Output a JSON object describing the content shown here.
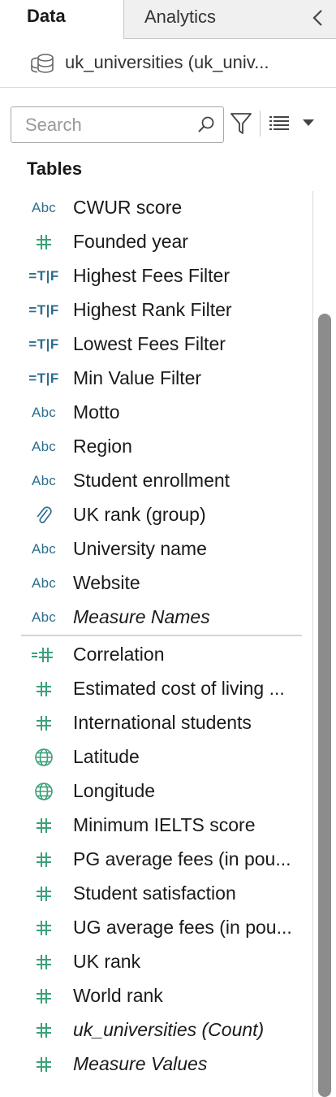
{
  "tabs": {
    "data": "Data",
    "analytics": "Analytics"
  },
  "datasource": {
    "name": "uk_universities (uk_univ..."
  },
  "search": {
    "placeholder": "Search"
  },
  "tables_heading": "Tables",
  "colors": {
    "accent_blue": "#2d6d8f",
    "measure_green": "#3aa178",
    "scrollbar": "#8c8c8c"
  },
  "dimensions": [
    {
      "icon": "abc",
      "label": "CWUR score"
    },
    {
      "icon": "number",
      "label": "Founded year"
    },
    {
      "icon": "calc-filter",
      "label": "Highest Fees Filter"
    },
    {
      "icon": "calc-filter",
      "label": "Highest Rank Filter"
    },
    {
      "icon": "calc-filter",
      "label": "Lowest Fees Filter"
    },
    {
      "icon": "calc-filter",
      "label": "Min Value Filter"
    },
    {
      "icon": "abc",
      "label": "Motto"
    },
    {
      "icon": "abc",
      "label": "Region"
    },
    {
      "icon": "abc",
      "label": "Student enrollment"
    },
    {
      "icon": "paperclip",
      "label": "UK rank (group)"
    },
    {
      "icon": "abc",
      "label": "University name"
    },
    {
      "icon": "abc",
      "label": "Website"
    },
    {
      "icon": "abc",
      "label": "Measure Names"
    }
  ],
  "measures": [
    {
      "icon": "calc-number",
      "label": "Correlation"
    },
    {
      "icon": "number",
      "label": "Estimated cost of living ..."
    },
    {
      "icon": "number",
      "label": "International students"
    },
    {
      "icon": "globe",
      "label": "Latitude"
    },
    {
      "icon": "globe",
      "label": "Longitude"
    },
    {
      "icon": "number",
      "label": "Minimum IELTS score"
    },
    {
      "icon": "number",
      "label": "PG average fees (in pou..."
    },
    {
      "icon": "number",
      "label": "Student satisfaction"
    },
    {
      "icon": "number",
      "label": "UG average fees (in pou..."
    },
    {
      "icon": "number",
      "label": "UK rank"
    },
    {
      "icon": "number",
      "label": "World rank"
    },
    {
      "icon": "number",
      "label": "uk_universities (Count)"
    },
    {
      "icon": "number",
      "label": "Measure Values"
    }
  ],
  "icon_text": {
    "abc": "Abc",
    "calc_filter": "=T|F"
  }
}
